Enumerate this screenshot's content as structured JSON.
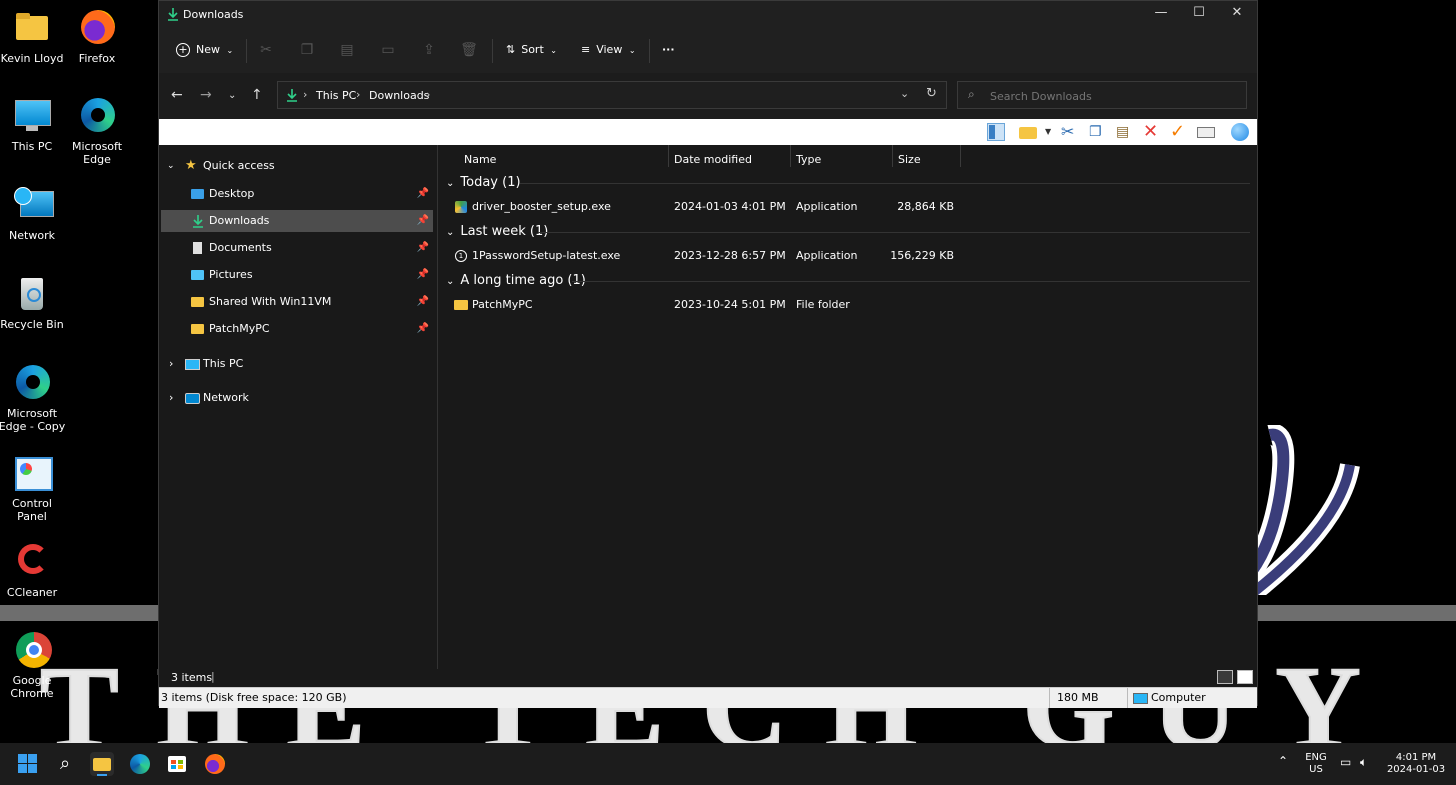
{
  "desktop": {
    "icons": [
      {
        "label": "Kevin Lloyd"
      },
      {
        "label": "Firefox"
      },
      {
        "label": "This PC"
      },
      {
        "label": "Microsoft Edge"
      },
      {
        "label": "Network"
      },
      {
        "label": "Recycle Bin"
      },
      {
        "label": "Microsoft Edge - Copy"
      },
      {
        "label": "Control Panel"
      },
      {
        "label": "CCleaner"
      },
      {
        "label": "Google Chrome"
      }
    ],
    "wallpaper_text": "THE TECH GUY"
  },
  "window": {
    "title": "Downloads",
    "controls": {
      "minimize": "—",
      "maximize": "☐",
      "close": "✕"
    }
  },
  "command_bar": {
    "new_label": "New",
    "sort_label": "Sort",
    "view_label": "View",
    "more_label": "···"
  },
  "address_bar": {
    "crumbs": [
      "This PC",
      "Downloads"
    ],
    "search_placeholder": "Search Downloads"
  },
  "sidebar": {
    "quick_access": "Quick access",
    "items": [
      {
        "label": "Desktop",
        "pinned": true
      },
      {
        "label": "Downloads",
        "pinned": true,
        "selected": true
      },
      {
        "label": "Documents",
        "pinned": true
      },
      {
        "label": "Pictures",
        "pinned": true
      },
      {
        "label": "Shared With Win11VM",
        "pinned": true
      },
      {
        "label": "PatchMyPC",
        "pinned": true
      }
    ],
    "this_pc": "This PC",
    "network": "Network"
  },
  "columns": {
    "name": "Name",
    "date": "Date modified",
    "type": "Type",
    "size": "Size"
  },
  "groups": [
    {
      "header": "Today (1)",
      "files": [
        {
          "name": "driver_booster_setup.exe",
          "date": "2024-01-03 4:01 PM",
          "type": "Application",
          "size": "28,864 KB"
        }
      ]
    },
    {
      "header": "Last week (1)",
      "files": [
        {
          "name": "1PasswordSetup-latest.exe",
          "date": "2023-12-28 6:57 PM",
          "type": "Application",
          "size": "156,229 KB"
        }
      ]
    },
    {
      "header": "A long time ago (1)",
      "files": [
        {
          "name": "PatchMyPC",
          "date": "2023-10-24 5:01 PM",
          "type": "File folder",
          "size": ""
        }
      ]
    }
  ],
  "status": {
    "items_count": "3 items",
    "legacy_left": "3 items (Disk free space: 120 GB)",
    "legacy_size": "180 MB",
    "legacy_location": "Computer"
  },
  "taskbar": {
    "lang_top": "ENG",
    "lang_bottom": "US",
    "time": "4:01 PM",
    "date": "2024-01-03"
  },
  "colors": {
    "folder_yellow": "#f5c542",
    "accent_blue": "#1ba1e2",
    "download_green": "#2fd08a"
  }
}
